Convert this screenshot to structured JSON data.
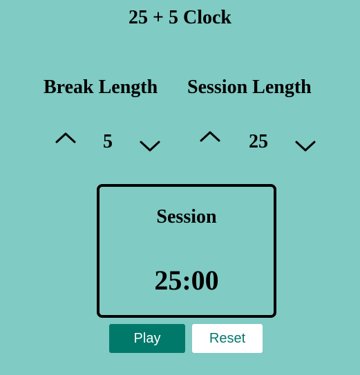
{
  "app": {
    "title": "25 + 5 Clock"
  },
  "break": {
    "label": "Break Length",
    "value": "5",
    "increment_icon": "chevron-up-icon",
    "decrement_icon": "chevron-down-icon"
  },
  "session": {
    "label": "Session Length",
    "value": "25",
    "increment_icon": "chevron-up-icon",
    "decrement_icon": "chevron-down-icon"
  },
  "timer": {
    "label": "Session",
    "time": "25:00"
  },
  "controls": {
    "play_label": "Play",
    "reset_label": "Reset"
  },
  "colors": {
    "background": "#80cbc4",
    "primary": "#00796b",
    "text": "#000000",
    "button_light": "#ffffff"
  }
}
